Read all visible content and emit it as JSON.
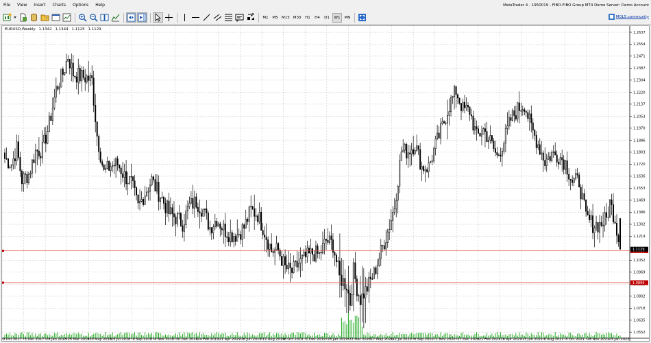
{
  "menu": [
    "File",
    "View",
    "Insert",
    "Charts",
    "Options",
    "Help"
  ],
  "window_title": "MetaTrader 4 - 1950019 - FIBO-FIBO Group MT4 Demo Server: Demo Account",
  "toolbar": {
    "timeframes": [
      "M1",
      "M5",
      "M15",
      "M30",
      "H1",
      "H4",
      "D1",
      "W1",
      "MN"
    ],
    "active_timeframe": "W1",
    "community_label": "MQL5.community"
  },
  "chart": {
    "symbol_label": "EURUSD,Weekly",
    "ohlc": [
      "1.1342",
      "1.1344",
      "1.1125",
      "1.1129"
    ],
    "price_labels": [
      "1.2637",
      "1.2554",
      "1.2471",
      "1.2387",
      "1.2304",
      "1.2220",
      "1.2137",
      "1.2053",
      "1.1970",
      "1.1886",
      "1.1803",
      "1.1720",
      "1.1636",
      "1.1553",
      "1.1469",
      "1.1386",
      "1.1302",
      "1.1219",
      "1.1052",
      "1.0969",
      "1.0885",
      "1.0802",
      "1.0718",
      "1.0635",
      "1.0552"
    ],
    "price_range": [
      1.051,
      1.268
    ],
    "current_price": "1.1129",
    "current_price_tag": "1.1118",
    "hlines": [
      {
        "value": "1.1118",
        "color": "#e74c3c",
        "tag_color": "#c00000"
      },
      {
        "value": "1.0896",
        "color": "#e74c3c",
        "tag_color": "#c00000"
      }
    ],
    "date_labels": [
      "9 Oct 2017",
      "3 Dec 2017",
      "28 Jan 2018",
      "25 Mar 2018",
      "20 May 2018",
      "15 Jul 2018",
      "9 Sep 2018",
      "4 Nov 2018",
      "30 Dec 2018",
      "24 Feb 2019",
      "21 Apr 2019",
      "16 Jun 2019",
      "11 Aug 2019",
      "6 Oct 2019",
      "1 Dec 2019",
      "26 Jan 2020",
      "22 Mar 2020",
      "17 May 2020",
      "12 Jul 2020",
      "6 Sep 2020",
      "1 Nov 2020",
      "27 Dec 2020",
      "21 Feb 2021",
      "18 Apr 2021",
      "13 Jun 2021",
      "8 Aug 2021",
      "3 Oct 2021",
      "28 Nov 2021",
      "23 Jan 2022"
    ],
    "anchors": [
      [
        0,
        1.176
      ],
      [
        4,
        1.172
      ],
      [
        7,
        1.183
      ],
      [
        10,
        1.161
      ],
      [
        14,
        1.165
      ],
      [
        18,
        1.181
      ],
      [
        22,
        1.182
      ],
      [
        26,
        1.2
      ],
      [
        30,
        1.224
      ],
      [
        34,
        1.235
      ],
      [
        37,
        1.247
      ],
      [
        40,
        1.235
      ],
      [
        44,
        1.233
      ],
      [
        48,
        1.232
      ],
      [
        51,
        1.23
      ],
      [
        54,
        1.192
      ],
      [
        58,
        1.166
      ],
      [
        62,
        1.171
      ],
      [
        66,
        1.172
      ],
      [
        70,
        1.164
      ],
      [
        74,
        1.159
      ],
      [
        78,
        1.142
      ],
      [
        82,
        1.152
      ],
      [
        86,
        1.161
      ],
      [
        88,
        1.156
      ],
      [
        92,
        1.148
      ],
      [
        96,
        1.138
      ],
      [
        100,
        1.135
      ],
      [
        104,
        1.131
      ],
      [
        108,
        1.143
      ],
      [
        112,
        1.146
      ],
      [
        116,
        1.14
      ],
      [
        120,
        1.128
      ],
      [
        124,
        1.134
      ],
      [
        128,
        1.127
      ],
      [
        132,
        1.123
      ],
      [
        136,
        1.123
      ],
      [
        140,
        1.128
      ],
      [
        144,
        1.14
      ],
      [
        148,
        1.137
      ],
      [
        152,
        1.125
      ],
      [
        156,
        1.112
      ],
      [
        160,
        1.112
      ],
      [
        164,
        1.1
      ],
      [
        168,
        1.097
      ],
      [
        172,
        1.103
      ],
      [
        176,
        1.107
      ],
      [
        180,
        1.11
      ],
      [
        184,
        1.109
      ],
      [
        188,
        1.119
      ],
      [
        192,
        1.116
      ],
      [
        196,
        1.093
      ],
      [
        200,
        1.088
      ],
      [
        202,
        1.076
      ],
      [
        204,
        1.098
      ],
      [
        206,
        1.086
      ],
      [
        208,
        1.078
      ],
      [
        212,
        1.086
      ],
      [
        216,
        1.096
      ],
      [
        220,
        1.111
      ],
      [
        224,
        1.125
      ],
      [
        228,
        1.143
      ],
      [
        232,
        1.181
      ],
      [
        236,
        1.181
      ],
      [
        240,
        1.186
      ],
      [
        244,
        1.17
      ],
      [
        248,
        1.17
      ],
      [
        252,
        1.185
      ],
      [
        256,
        1.198
      ],
      [
        260,
        1.213
      ],
      [
        264,
        1.223
      ],
      [
        268,
        1.21
      ],
      [
        272,
        1.209
      ],
      [
        276,
        1.191
      ],
      [
        280,
        1.196
      ],
      [
        284,
        1.188
      ],
      [
        288,
        1.177
      ],
      [
        292,
        1.188
      ],
      [
        296,
        1.203
      ],
      [
        300,
        1.21
      ],
      [
        304,
        1.214
      ],
      [
        308,
        1.197
      ],
      [
        312,
        1.186
      ],
      [
        316,
        1.174
      ],
      [
        320,
        1.179
      ],
      [
        324,
        1.178
      ],
      [
        328,
        1.173
      ],
      [
        332,
        1.16
      ],
      [
        336,
        1.16
      ],
      [
        340,
        1.135
      ],
      [
        344,
        1.13
      ],
      [
        348,
        1.13
      ],
      [
        352,
        1.134
      ],
      [
        354,
        1.145
      ],
      [
        357,
        1.134
      ],
      [
        360,
        1.113
      ]
    ],
    "last_candle": {
      "open": 1.1342,
      "high": 1.1344,
      "low": 1.1125,
      "close": 1.1129
    }
  }
}
